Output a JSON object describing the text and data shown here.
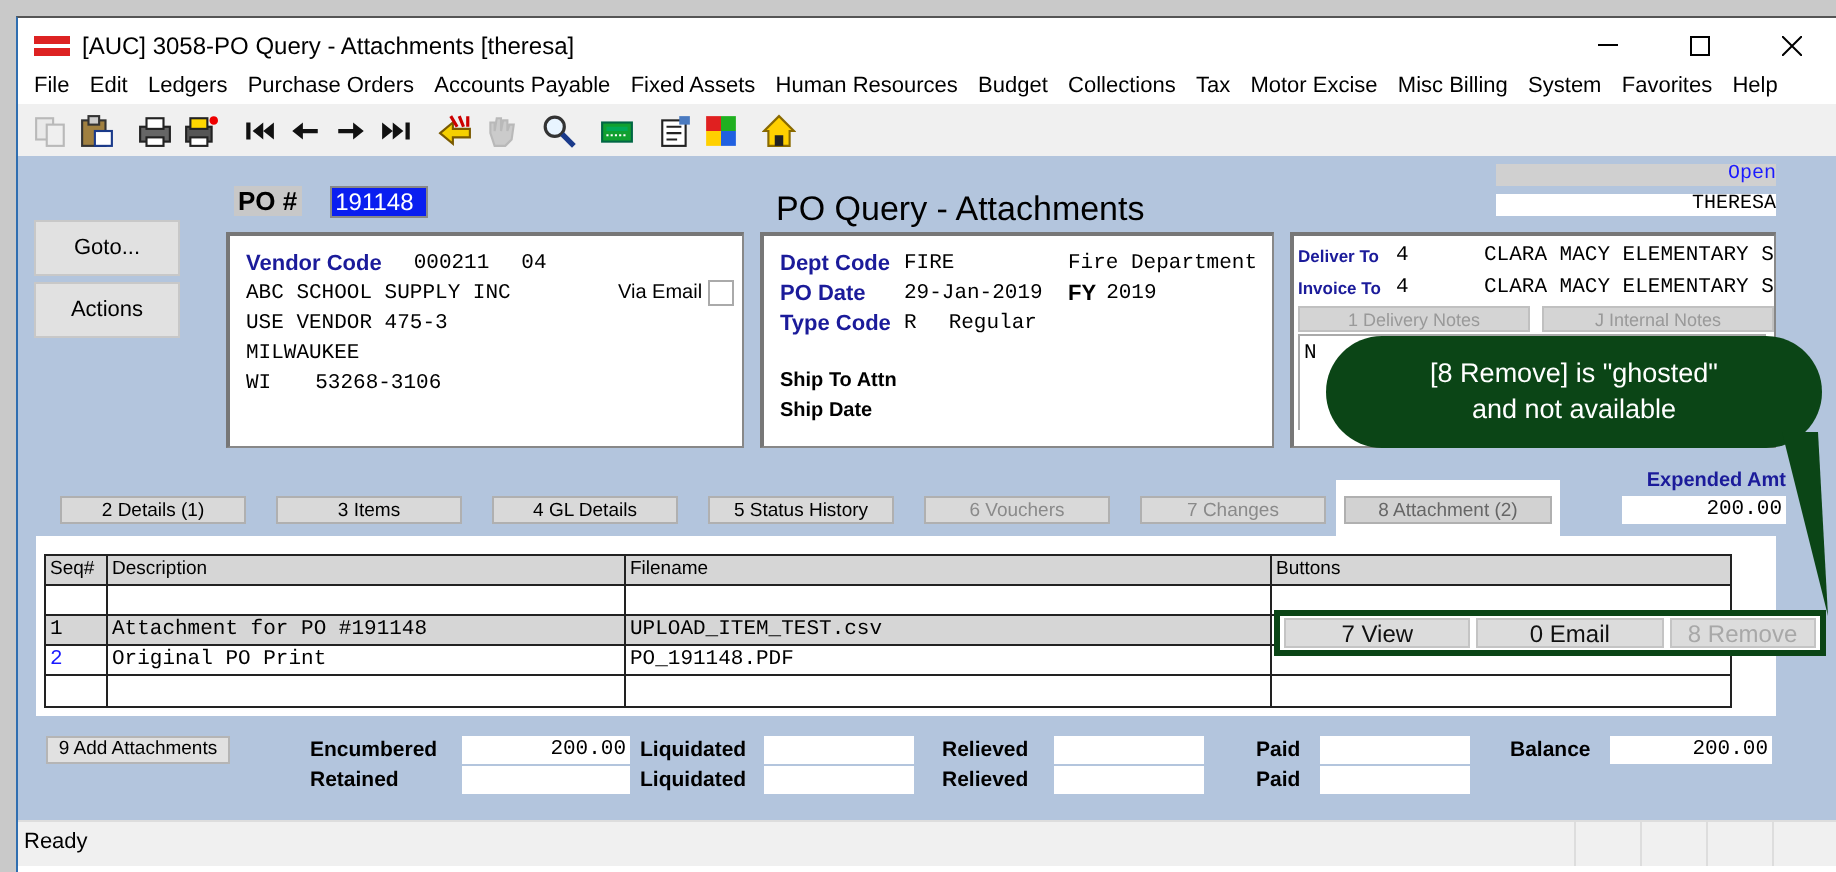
{
  "window": {
    "title": "[AUC] 3058-PO Query - Attachments [theresa]"
  },
  "menu": [
    "File",
    "Edit",
    "Ledgers",
    "Purchase Orders",
    "Accounts Payable",
    "Fixed Assets",
    "Human Resources",
    "Budget",
    "Collections",
    "Tax",
    "Motor Excise",
    "Misc Billing",
    "System",
    "Favorites",
    "Help"
  ],
  "toolbar": [
    [
      {
        "kind": "copy",
        "disabled": true
      },
      {
        "kind": "paste",
        "disabled": false
      }
    ],
    [
      {
        "kind": "print",
        "disabled": false
      },
      {
        "kind": "print-setup",
        "disabled": false
      }
    ],
    [
      {
        "kind": "first",
        "disabled": false
      },
      {
        "kind": "previous",
        "disabled": false
      },
      {
        "kind": "next",
        "disabled": false
      },
      {
        "kind": "last",
        "disabled": false
      }
    ],
    [
      {
        "kind": "exit",
        "disabled": false
      },
      {
        "kind": "hand",
        "disabled": true
      }
    ],
    [
      {
        "kind": "search",
        "disabled": false
      }
    ],
    [
      {
        "kind": "calculator",
        "disabled": false
      }
    ],
    [
      {
        "kind": "notes",
        "disabled": false
      },
      {
        "kind": "colors",
        "disabled": false
      }
    ],
    [
      {
        "kind": "home",
        "disabled": false
      }
    ]
  ],
  "po": {
    "label": "PO #",
    "number": "191148"
  },
  "page_title": "PO Query - Attachments",
  "status": {
    "state": "Open",
    "user": "THERESA"
  },
  "side_buttons": [
    "Goto...",
    "Actions"
  ],
  "vendor": {
    "code_label": "Vendor Code",
    "code": "000211",
    "remit": "04",
    "lines": [
      "ABC SCHOOL SUPPLY INC",
      "USE VENDOR 475-3",
      "MILWAUKEE"
    ],
    "state": "WI",
    "zip": "53268-3106",
    "via_email": {
      "label": "Via Email",
      "checked": false
    }
  },
  "order": {
    "rows": [
      {
        "label": "Dept Code",
        "value": "FIRE",
        "note": "Fire Department"
      },
      {
        "label": "PO Date",
        "value": "29-Jan-2019",
        "note_label": "FY",
        "note": "2019"
      },
      {
        "label": "Type Code",
        "value": "R",
        "description": "Regular"
      }
    ],
    "ship": [
      "Ship To Attn",
      "Ship Date"
    ]
  },
  "delivery": {
    "rows": [
      {
        "label": "Deliver To",
        "code": "4",
        "name": "CLARA MACY ELEMENTARY S"
      },
      {
        "label": "Invoice To",
        "code": "4",
        "name": "CLARA MACY ELEMENTARY S"
      }
    ],
    "note_tabs": [
      {
        "label": "1 Delivery Notes",
        "disabled": true
      },
      {
        "label": "J Internal Notes",
        "disabled": true
      }
    ],
    "note_text": "N"
  },
  "tabs": [
    {
      "label": "2 Details (1)",
      "selected": false,
      "disabled": false
    },
    {
      "label": "3 Items",
      "selected": false,
      "disabled": false
    },
    {
      "label": "4 GL Details",
      "selected": false,
      "disabled": false
    },
    {
      "label": "5 Status History",
      "selected": false,
      "disabled": false
    },
    {
      "label": "6 Vouchers",
      "selected": false,
      "disabled": true
    },
    {
      "label": "7 Changes",
      "selected": false,
      "disabled": true
    },
    {
      "label": "8 Attachment (2)",
      "selected": true,
      "disabled": false
    }
  ],
  "expended": {
    "label": "Expended Amt",
    "value": "200.00"
  },
  "table": {
    "columns": [
      "Seq#",
      "Description",
      "Filename",
      "Buttons"
    ],
    "rows": [
      {
        "seq": "1",
        "description": "Attachment for PO #191148",
        "filename": "UPLOAD_ITEM_TEST.csv",
        "selected": true,
        "current": false
      },
      {
        "seq": "2",
        "description": "Original PO Print",
        "filename": "PO_191148.PDF",
        "selected": false,
        "current": true
      }
    ],
    "row_buttons": [
      {
        "label": "7 View",
        "disabled": false
      },
      {
        "label": "0 Email",
        "disabled": false
      },
      {
        "label": "8 Remove",
        "disabled": true
      }
    ]
  },
  "add_button": "9 Add Attachments",
  "totals": [
    [
      {
        "label": "Encumbered",
        "value": "200.00"
      },
      {
        "label": "Liquidated"
      },
      {
        "label": "Relieved"
      },
      {
        "label": "Paid"
      },
      {
        "label": "Balance",
        "value": "200.00"
      }
    ],
    [
      {
        "label": "Retained"
      },
      {
        "label": "Liquidated"
      },
      {
        "label": "Relieved"
      },
      {
        "label": "Paid"
      }
    ]
  ],
  "callout": {
    "lines": [
      "[8 Remove] is \"ghosted\"",
      "and not available"
    ]
  },
  "status_bar": {
    "text": "Ready"
  }
}
